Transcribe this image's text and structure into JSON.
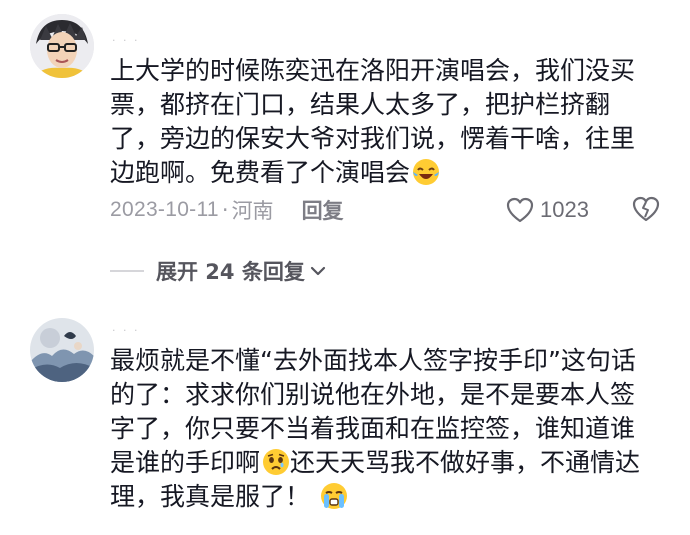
{
  "comments": [
    {
      "username": "· · ·",
      "text": "上大学的时候陈奕迅在洛阳开演唱会，我们没买票，都挤在门口，结果人太多了，把护栏挤翻了，旁边的保安大爷对我们说，愣着干啥，往里边跑啊。免费看了个演唱会",
      "emoji": "laughing-tears-emoji",
      "date": "2023-10-11",
      "location": "河南",
      "reply_label": "回复",
      "likes": "1023",
      "expand_label": "展开 24 条回复"
    },
    {
      "username": "· · ·",
      "text_part1": "最烦就是不懂“去外面找本人签字按手印”这句话的了：求求你们别说他在外地，是不是要本人签字了，你只要不当着我面和在监控签，谁知道谁是谁的手印啊",
      "emoji1": "worried-emoji",
      "text_part2": "还天天骂我不做好事，不通情达理，我真是服了！",
      "emoji2": "crying-emoji"
    }
  ],
  "colors": {
    "text": "#161823",
    "meta": "#9b9ba3",
    "divider": "#d6d6da"
  }
}
